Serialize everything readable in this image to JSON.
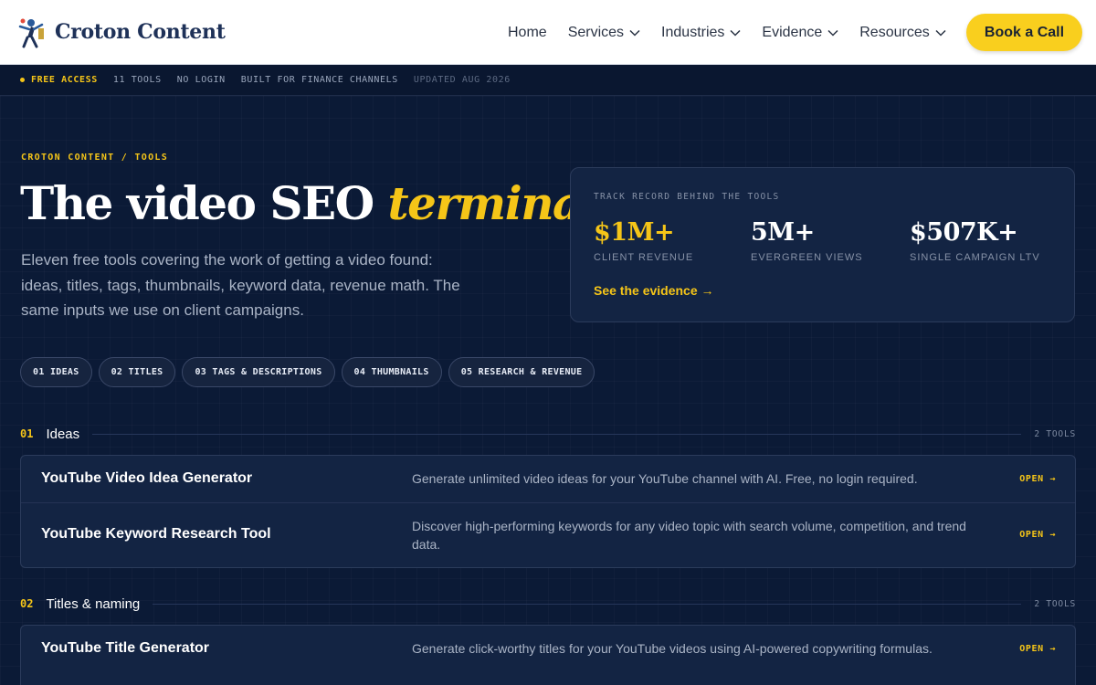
{
  "brand": {
    "name": "Croton Content"
  },
  "nav": {
    "links": [
      {
        "label": "Home",
        "dropdown": false
      },
      {
        "label": "Services",
        "dropdown": true
      },
      {
        "label": "Industries",
        "dropdown": true
      },
      {
        "label": "Evidence",
        "dropdown": true
      },
      {
        "label": "Resources",
        "dropdown": true
      }
    ],
    "cta": "Book a Call"
  },
  "strip": {
    "free": "FREE ACCESS",
    "tools": "11 TOOLS",
    "login": "NO LOGIN",
    "built": "BUILT FOR FINANCE CHANNELS",
    "updated": "UPDATED AUG 2026"
  },
  "hero": {
    "breadcrumb": "CROTON CONTENT / TOOLS",
    "title_main": "The video SEO ",
    "title_accent": "terminal",
    "subtitle": "Eleven free tools covering the work of getting a video found: ideas, titles, tags, thumbnails, keyword data, revenue math. The same inputs we use on client campaigns."
  },
  "stats": {
    "label": "TRACK RECORD BEHIND THE TOOLS",
    "items": [
      {
        "value": "$1M+",
        "caption": "CLIENT REVENUE"
      },
      {
        "value": "5M+",
        "caption": "EVERGREEN VIEWS"
      },
      {
        "value": "$507K+",
        "caption": "SINGLE CAMPAIGN LTV"
      }
    ],
    "link": "See the evidence →"
  },
  "pills": [
    "01 IDEAS",
    "02 TITLES",
    "03 TAGS & DESCRIPTIONS",
    "04 THUMBNAILS",
    "05 RESEARCH & REVENUE"
  ],
  "sections": [
    {
      "num": "01",
      "title": "Ideas",
      "count": "2 TOOLS",
      "tools": [
        {
          "name": "YouTube Video Idea Generator",
          "desc": "Generate unlimited video ideas for your YouTube channel with AI. Free, no login required.",
          "open": "OPEN →"
        },
        {
          "name": "YouTube Keyword Research Tool",
          "desc": "Discover high-performing keywords for any video topic with search volume, competition, and trend data.",
          "open": "OPEN →"
        }
      ]
    },
    {
      "num": "02",
      "title": "Titles & naming",
      "count": "2 TOOLS",
      "tools": [
        {
          "name": "YouTube Title Generator",
          "desc": "Generate click-worthy titles for your YouTube videos using AI-powered copywriting formulas.",
          "open": "OPEN →"
        }
      ]
    }
  ]
}
